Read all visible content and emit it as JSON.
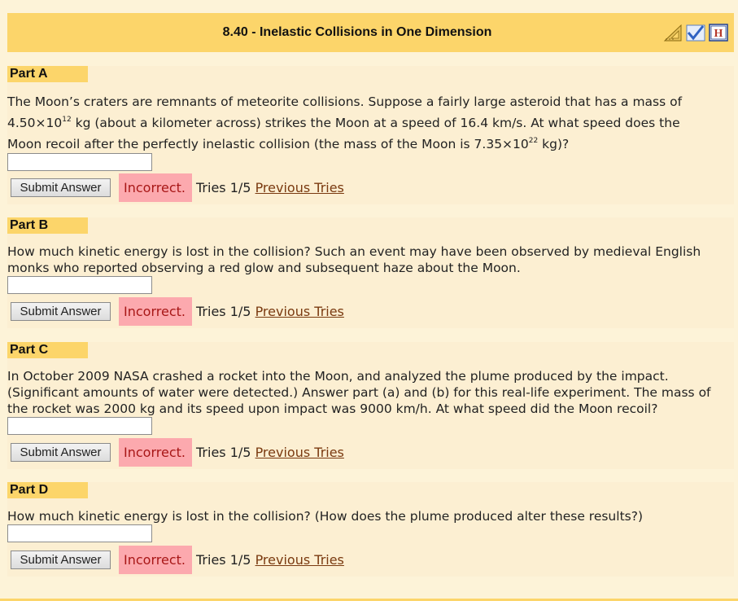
{
  "header": {
    "title": "8.40 - Inelastic Collisions in One Dimension",
    "icons": [
      "triangle-ruler-icon",
      "checkmark-icon",
      "help-icon"
    ]
  },
  "parts": [
    {
      "label": "Part A",
      "lines": [
        [
          "The Moon’s craters are remnants of meteorite collisions. Suppose a fairly large asteroid that has a mass of"
        ],
        [
          "4.50×10",
          "12",
          " kg (about a kilometer across) strikes the Moon at a speed of 16.4 km/s. At what speed does the"
        ],
        [
          "Moon recoil after the perfectly inelastic collision (the mass of the Moon is 7.35×10",
          "22",
          " kg)?"
        ]
      ],
      "answer_value": "",
      "submit_label": "Submit Answer",
      "status": "Incorrect.",
      "tries": "Tries 1/5",
      "previous_tries": "Previous Tries"
    },
    {
      "label": "Part B",
      "question_line1": "How much kinetic energy is lost in the collision? Such an event may have been observed by medieval English",
      "question_line2": "monks who reported observing a red glow and subsequent haze about the Moon.",
      "answer_value": "",
      "submit_label": "Submit Answer",
      "status": "Incorrect.",
      "tries": "Tries 1/5",
      "previous_tries": "Previous Tries"
    },
    {
      "label": "Part C",
      "question_line1": "In October 2009 NASA crashed a rocket into the Moon, and analyzed the plume produced by the impact.",
      "question_line2": "(Significant amounts of water were detected.) Answer part (a) and (b) for this real-life experiment. The mass of",
      "question_line3": "the rocket was 2000 kg and its speed upon impact was 9000 km/h. At what speed did the Moon recoil?",
      "answer_value": "",
      "submit_label": "Submit Answer",
      "status": "Incorrect.",
      "tries": "Tries 1/5",
      "previous_tries": "Previous Tries"
    },
    {
      "label": "Part D",
      "question_line1": "How much kinetic energy is lost in the collision? (How does the plume produced alter these results?)",
      "answer_value": "",
      "submit_label": "Submit Answer",
      "status": "Incorrect.",
      "tries": "Tries 1/5",
      "previous_tries": "Previous Tries"
    }
  ],
  "colors": {
    "page_background": "#fdf3d8",
    "header_background": "#fcd56a",
    "part_background": "#fcefd2",
    "incorrect_background": "#fca9ae",
    "incorrect_text": "#a81717",
    "link": "#7a3a10"
  }
}
